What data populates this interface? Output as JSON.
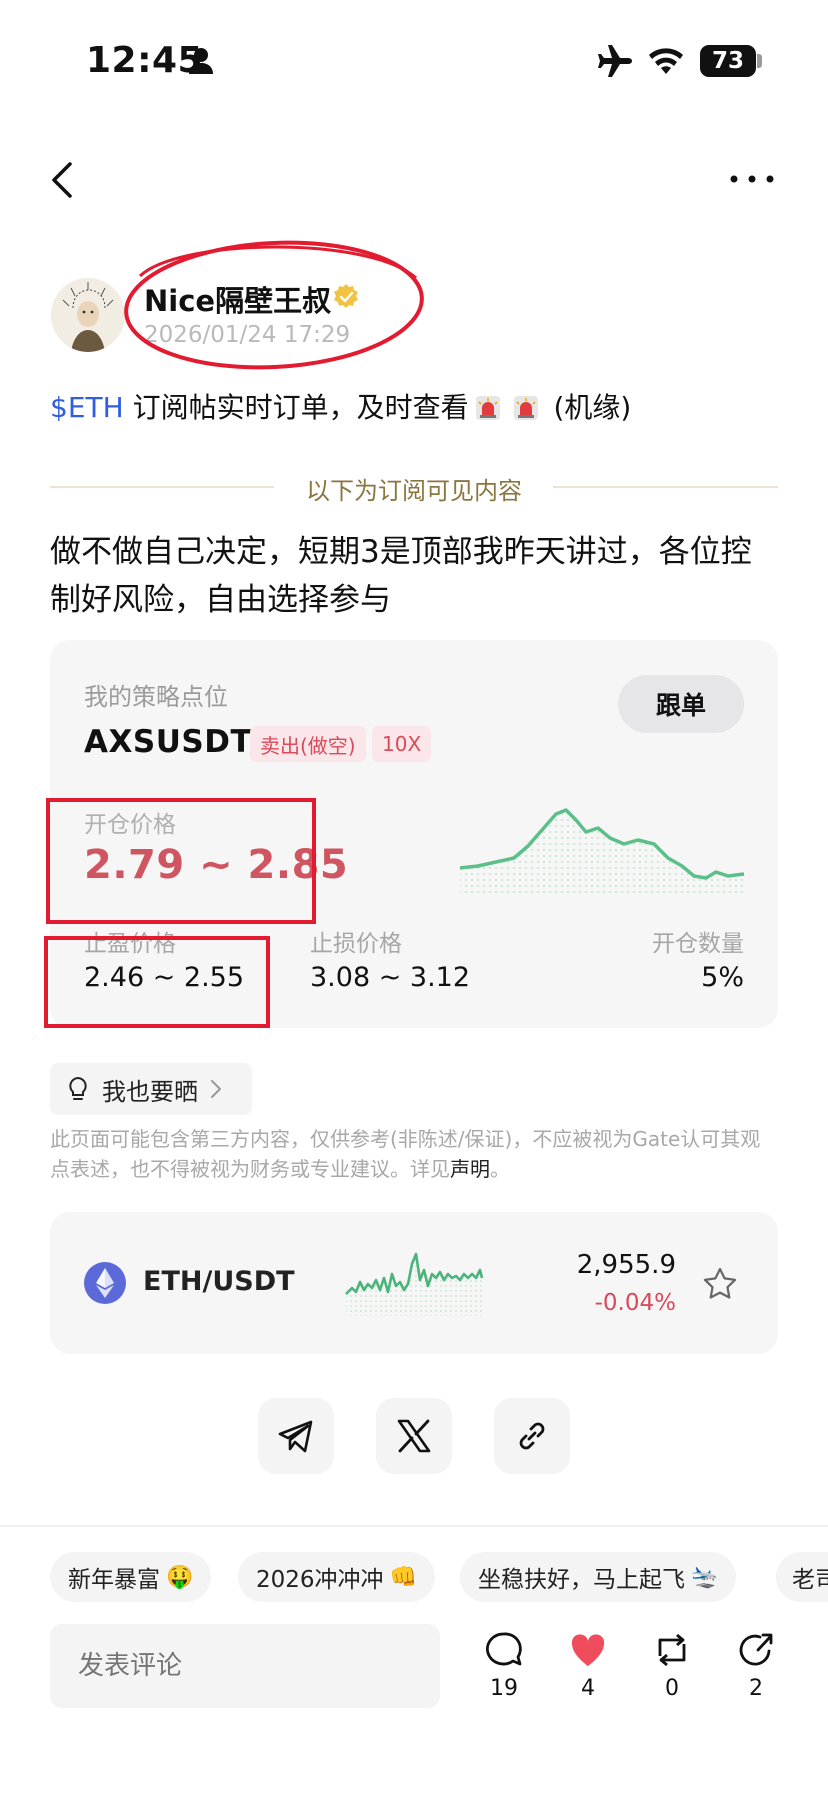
{
  "status_bar": {
    "time": "12:45",
    "battery": "73",
    "icons": [
      "person-icon",
      "airplane-icon",
      "wifi-icon",
      "battery-icon"
    ]
  },
  "nav": {
    "back_icon": "chevron-left-icon",
    "more_icon": "more-dots-icon"
  },
  "post": {
    "author": "Nice隔壁王叔",
    "timestamp": "2026/01/24 17:29",
    "title_ticker": "$ETH",
    "title_text": " 订阅帖实时订单，及时查看",
    "title_suffix": " (机缘)",
    "divider_text": "以下为订阅可见内容",
    "body": "做不做自己决定，短期3是顶部我昨天讲过，各位控制好风险，自由选择参与"
  },
  "strategy": {
    "label": "我的策略点位",
    "follow_button": "跟单",
    "pair": "AXSUSDT",
    "side": "卖出(做空)",
    "leverage": "10X",
    "open_label": "开仓价格",
    "open_value": "2.79 ~ 2.85",
    "tp_label": "止盈价格",
    "tp_value": "2.46 ~ 2.55",
    "sl_label": "止损价格",
    "sl_value": "3.08 ~ 3.12",
    "qty_label": "开仓数量",
    "qty_value": "5%",
    "sparkline_color": "#5cbf8a"
  },
  "share": {
    "label": "我也要晒"
  },
  "disclaimer": {
    "text": "此页面可能包含第三方内容，仅供参考(非陈述/保证)，不应被视为Gate认可其观点表述，也不得被视为财务或专业建议。详见",
    "link": "声明",
    "end": "。"
  },
  "market": {
    "pair": "ETH/USDT",
    "price": "2,955.9",
    "change": "-0.04%",
    "change_color": "#d94a5a"
  },
  "share_buttons": [
    "telegram-icon",
    "x-logo-icon",
    "link-icon"
  ],
  "tags": [
    {
      "text": "新年暴富",
      "emoji": "🤑"
    },
    {
      "text": "2026冲冲冲",
      "emoji": "👊"
    },
    {
      "text": "坐稳扶好，马上起飞",
      "emoji": "🛬"
    },
    {
      "text": "老司"
    }
  ],
  "comment": {
    "placeholder": "发表评论"
  },
  "actions": {
    "comments": "19",
    "likes": "4",
    "reposts": "0",
    "shares": "2"
  },
  "accent_color": "#2f5fe0",
  "annotation_color": "#e21b30"
}
